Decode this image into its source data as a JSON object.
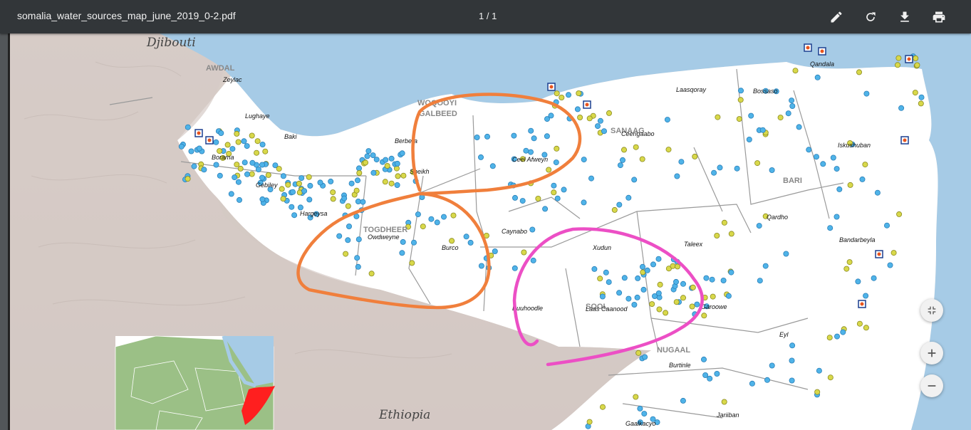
{
  "toolbar": {
    "file_name": "somalia_water_sources_map_june_2019_0-2.pdf",
    "page_indicator": "1 / 1",
    "buttons": [
      {
        "name": "annotate",
        "icon": "pencil-icon"
      },
      {
        "name": "rotate",
        "icon": "rotate-icon"
      },
      {
        "name": "download",
        "icon": "download-icon"
      },
      {
        "name": "print",
        "icon": "print-icon"
      }
    ]
  },
  "map": {
    "countries": {
      "djibouti": "Djibouti",
      "ethiopia": "Ethiopia"
    },
    "regions": {
      "awdal": "AWDAL",
      "woqooyi": "WOQOOYI",
      "galbeed": "GALBEED",
      "sanaag": "SANAAG",
      "togdheer": "TOGDHEER",
      "bari": "BARI",
      "sool": "SOOL",
      "nugaal": "NUGAAL"
    },
    "places": {
      "zeylac": "Zeylac",
      "lughaye": "Lughaye",
      "baki": "Baki",
      "borama": "Borama",
      "gebiley": "Gebiley",
      "berbera": "Berbera",
      "hargeysa": "Hargeysa",
      "sheikh": "Sheikh",
      "ceel_afweyn": "Ceel Afweyn",
      "erigabo": "Ceerigaabo",
      "laasqoray": "Laasqoray",
      "qandala": "Qandala",
      "bosaso": "Bossaso",
      "iskushuban": "Iskushuban",
      "owdweyne": "Owdweyne",
      "burco": "Burco",
      "caynabo": "Caynabo",
      "xudun": "Xudun",
      "taleex": "Taleex",
      "qardho": "Qardho",
      "bandarbeyla": "Bandarbeyla",
      "buuhoodle": "Buuhoodle",
      "laas_caanood": "Laas Caanood",
      "garoowe": "Garoowe",
      "eyl": "Eyl",
      "burtinle": "Burtinle",
      "jariiban": "Jariiban",
      "gaalkacyo": "Gaalkacyo"
    }
  },
  "zoom_controls": {
    "fit": "fit-page-icon",
    "zoom_in": "plus-icon",
    "zoom_out": "minus-icon"
  },
  "colors": {
    "toolbar_bg": "#323639",
    "water_point_blue": "#4fb3e8",
    "water_point_yellow": "#d8d84a",
    "annotation_orange": "#f07f3c",
    "annotation_magenta": "#ec4fc5",
    "sea": "#a6cbe6"
  }
}
